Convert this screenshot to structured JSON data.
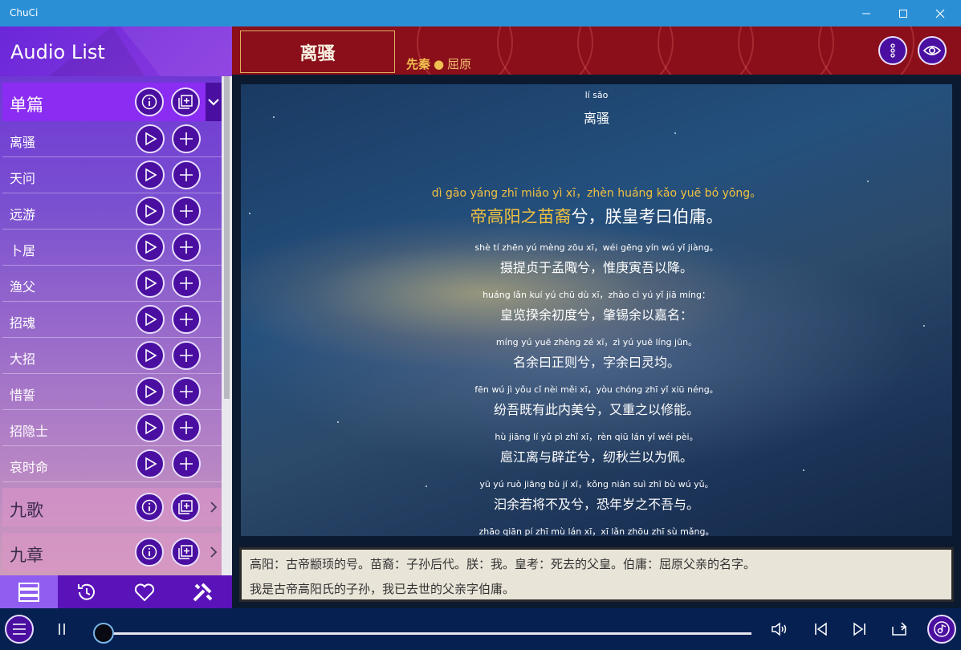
{
  "window": {
    "title": "ChuCi"
  },
  "sidebar": {
    "heading": "Audio List",
    "groups": [
      {
        "name": "单篇",
        "expanded": true
      },
      {
        "name": "九歌",
        "expanded": false
      },
      {
        "name": "九章",
        "expanded": false
      }
    ],
    "items": [
      {
        "label": "离骚"
      },
      {
        "label": "天问"
      },
      {
        "label": "远游"
      },
      {
        "label": "卜居"
      },
      {
        "label": "渔父"
      },
      {
        "label": "招魂"
      },
      {
        "label": "大招"
      },
      {
        "label": "惜誓"
      },
      {
        "label": "招隐士"
      },
      {
        "label": "哀时命"
      }
    ],
    "tabs": [
      "list-icon",
      "history-icon",
      "heart-icon",
      "tools-icon"
    ],
    "accent": "#8b2cf2"
  },
  "poem": {
    "title": "离骚",
    "dynasty": "先秦",
    "separator": "●",
    "author": "屈原",
    "title_pinyin": "lí sāo",
    "title_hanzi": "离骚",
    "current_line": {
      "pinyin": "dì gāo yáng zhī miáo yì xī，zhèn huáng kǎo yuē bó yōng。",
      "hanzi_highlight": "帝高阳之苗裔",
      "hanzi_rest": "兮，朕皇考曰伯庸。"
    },
    "lines": [
      {
        "pinyin": "shè tí zhēn yú mèng zōu xī，wéi gēng yín wú yǐ jiàng。",
        "hanzi": "摄提贞于孟陬兮，惟庚寅吾以降。"
      },
      {
        "pinyin": "huáng lǎn kuí yú chū dù xī，zhào cì yú yǐ jiā míng：",
        "hanzi": "皇览揆余初度兮，肇锡余以嘉名："
      },
      {
        "pinyin": "míng yú yuē zhèng zé xī，zì yú yuē líng jūn。",
        "hanzi": "名余曰正则兮，字余曰灵均。"
      },
      {
        "pinyin": "fēn wú jì yǒu cǐ nèi měi xī，yòu chóng zhī yǐ xiū néng。",
        "hanzi": "纷吾既有此内美兮，又重之以修能。"
      },
      {
        "pinyin": "hù jiāng lí yǔ pì zhǐ xī，rèn qiū lán yǐ wéi pèi。",
        "hanzi": "扈江离与辟芷兮，纫秋兰以为佩。"
      },
      {
        "pinyin": "yū yú ruò jiāng bù jí xī，kǒng nián suì zhī bù wú yǔ。",
        "hanzi": "汩余若将不及兮，恐年岁之不吾与。"
      },
      {
        "pinyin": "zhāo qiān pí zhī mù lán xī，xī lǎn zhōu zhī sù mǎng。",
        "hanzi": ""
      }
    ],
    "note_line1": "高阳：古帝颛顼的号。苗裔：子孙后代。朕：我。皇考：死去的父皇。伯庸：屈原父亲的名字。",
    "note_line2": "我是古帝高阳氏的子孙，我已去世的父亲字伯庸。",
    "highlight_color": "#f0c040",
    "band_color": "#8a0f1a"
  },
  "player": {
    "progress": 0.0,
    "controls": [
      "menu-icon",
      "pause-icon",
      "volume-icon",
      "previous-icon",
      "next-icon",
      "repeat-icon",
      "playlist-music-icon"
    ]
  }
}
